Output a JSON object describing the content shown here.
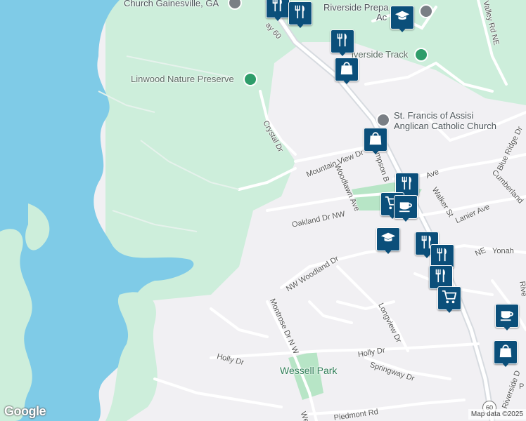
{
  "map": {
    "colors": {
      "water": "#7fcbe7",
      "land": "#f1f0f3",
      "green": "#cdeedb",
      "park": "#b7e5c6",
      "road": "#ffffff",
      "highway": "#d7dbe0",
      "marker": "#0b4f7a"
    },
    "places": {
      "church_gainesville": "Church Gainesville, GA",
      "riverside_prep": "Riverside Prepa",
      "riverside_prep2": "Ac",
      "riverside_track": "iverside Track",
      "linwood": "Linwood Nature Preserve",
      "st_francis_1": "St. Francis of Assisi",
      "st_francis_2": "Anglican Catholic Church",
      "wessell": "Wessell Park"
    },
    "streets": {
      "hwy60": "ay 60",
      "crystal": "Crystal Dr",
      "mountain_view": "Mountain View Dr",
      "thompson": "ompson B",
      "woodlawn": "Woodlawn Ave",
      "oakland": "Oakland Dr NW",
      "walker": "Walker St",
      "lanier": "Lanier Ave",
      "blue_ridge": "Blue Ridge Dr",
      "cumberland": "Cumberland",
      "ave": "Ave",
      "ne": "NE",
      "yonah": "Yonah",
      "nw_woodland": "NW Woodland Dr",
      "montrose": "Montrose Dr N W",
      "longview": "Longview Dr",
      "holly_left": "Holly Dr",
      "holly_right": "Holly Dr",
      "springway": "Springway Dr",
      "piedmont": "Piedmont Rd",
      "we": "We",
      "riverside_dr": "Riverside D",
      "valley": "Valley Rd NE",
      "p": "P",
      "rive": "Rive"
    },
    "route_shield": "60",
    "google": "Google",
    "attribution": "Map data ©2025"
  },
  "markers": [
    {
      "name": "restaurant-marker",
      "icon": "fork-knife-icon"
    },
    {
      "name": "restaurant-marker",
      "icon": "fork-knife-icon"
    },
    {
      "name": "school-marker",
      "icon": "graduation-cap-icon"
    },
    {
      "name": "restaurant-marker",
      "icon": "fork-knife-icon"
    },
    {
      "name": "shopping-marker",
      "icon": "shopping-bag-icon"
    },
    {
      "name": "shopping-marker",
      "icon": "shopping-bag-icon"
    },
    {
      "name": "restaurant-marker",
      "icon": "fork-knife-icon"
    },
    {
      "name": "grocery-marker",
      "icon": "cart-icon"
    },
    {
      "name": "cafe-marker",
      "icon": "coffee-icon"
    },
    {
      "name": "school-marker",
      "icon": "graduation-cap-icon"
    },
    {
      "name": "restaurant-marker",
      "icon": "fork-knife-icon"
    },
    {
      "name": "restaurant-marker",
      "icon": "fork-knife-icon"
    },
    {
      "name": "restaurant-marker",
      "icon": "fork-knife-icon"
    },
    {
      "name": "grocery-marker",
      "icon": "cart-icon"
    },
    {
      "name": "cafe-marker",
      "icon": "coffee-icon"
    },
    {
      "name": "shopping-marker",
      "icon": "shopping-bag-icon"
    }
  ]
}
